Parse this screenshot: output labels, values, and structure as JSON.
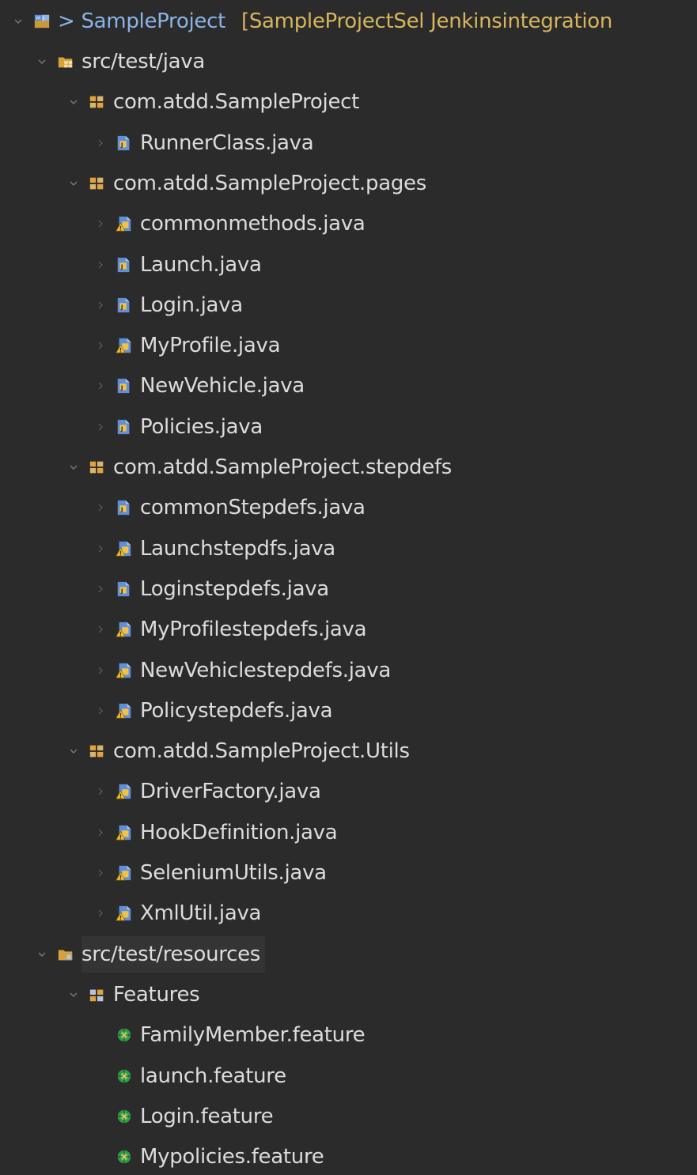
{
  "project": {
    "prefix": "> ",
    "name": "SampleProject",
    "decoration": "[SampleProjectSel Jenkinsintegration"
  },
  "tree": [
    {
      "label": "src/test/java",
      "kind": "source-folder",
      "depth": 1,
      "expanded": true,
      "icon": "source-folder-icon"
    },
    {
      "label": "com.atdd.SampleProject",
      "kind": "package",
      "depth": 2,
      "expanded": true,
      "icon": "package-icon"
    },
    {
      "label": "RunnerClass.java",
      "kind": "java",
      "depth": 3,
      "expanded": false,
      "icon": "java-file-icon"
    },
    {
      "label": "com.atdd.SampleProject.pages",
      "kind": "package",
      "depth": 2,
      "expanded": true,
      "icon": "package-icon"
    },
    {
      "label": "commonmethods.java",
      "kind": "java-warn",
      "depth": 3,
      "expanded": false,
      "icon": "java-file-warning-icon"
    },
    {
      "label": "Launch.java",
      "kind": "java",
      "depth": 3,
      "expanded": false,
      "icon": "java-file-icon"
    },
    {
      "label": "Login.java",
      "kind": "java",
      "depth": 3,
      "expanded": false,
      "icon": "java-file-icon"
    },
    {
      "label": "MyProfile.java",
      "kind": "java-warn",
      "depth": 3,
      "expanded": false,
      "icon": "java-file-warning-icon"
    },
    {
      "label": "NewVehicle.java",
      "kind": "java",
      "depth": 3,
      "expanded": false,
      "icon": "java-file-icon"
    },
    {
      "label": "Policies.java",
      "kind": "java",
      "depth": 3,
      "expanded": false,
      "icon": "java-file-icon"
    },
    {
      "label": "com.atdd.SampleProject.stepdefs",
      "kind": "package",
      "depth": 2,
      "expanded": true,
      "icon": "package-icon"
    },
    {
      "label": "commonStepdefs.java",
      "kind": "java",
      "depth": 3,
      "expanded": false,
      "icon": "java-file-icon"
    },
    {
      "label": "Launchstepdfs.java",
      "kind": "java-warn",
      "depth": 3,
      "expanded": false,
      "icon": "java-file-warning-icon"
    },
    {
      "label": "Loginstepdefs.java",
      "kind": "java",
      "depth": 3,
      "expanded": false,
      "icon": "java-file-icon"
    },
    {
      "label": "MyProfilestepdefs.java",
      "kind": "java-warn",
      "depth": 3,
      "expanded": false,
      "icon": "java-file-warning-icon"
    },
    {
      "label": "NewVehiclestepdefs.java",
      "kind": "java-warn",
      "depth": 3,
      "expanded": false,
      "icon": "java-file-warning-icon"
    },
    {
      "label": "Policystepdefs.java",
      "kind": "java-warn",
      "depth": 3,
      "expanded": false,
      "icon": "java-file-warning-icon"
    },
    {
      "label": "com.atdd.SampleProject.Utils",
      "kind": "package",
      "depth": 2,
      "expanded": true,
      "icon": "package-icon"
    },
    {
      "label": "DriverFactory.java",
      "kind": "java-warn",
      "depth": 3,
      "expanded": false,
      "icon": "java-file-warning-icon"
    },
    {
      "label": "HookDefinition.java",
      "kind": "java-warn",
      "depth": 3,
      "expanded": false,
      "icon": "java-file-warning-icon"
    },
    {
      "label": "SeleniumUtils.java",
      "kind": "java-warn",
      "depth": 3,
      "expanded": false,
      "icon": "java-file-warning-icon"
    },
    {
      "label": "XmlUtil.java",
      "kind": "java-warn",
      "depth": 3,
      "expanded": false,
      "icon": "java-file-warning-icon"
    },
    {
      "label": "src/test/resources",
      "kind": "resource-folder",
      "depth": 1,
      "expanded": true,
      "selected": true,
      "icon": "resource-folder-icon"
    },
    {
      "label": "Features",
      "kind": "folder-package",
      "depth": 2,
      "expanded": true,
      "icon": "folder-package-icon"
    },
    {
      "label": "FamilyMember.feature",
      "kind": "feature",
      "depth": 3,
      "icon": "cucumber-feature-icon"
    },
    {
      "label": "launch.feature",
      "kind": "feature",
      "depth": 3,
      "icon": "cucumber-feature-icon"
    },
    {
      "label": "Login.feature",
      "kind": "feature",
      "depth": 3,
      "icon": "cucumber-feature-icon"
    },
    {
      "label": "Mypolicies.feature",
      "kind": "feature",
      "depth": 3,
      "icon": "cucumber-feature-icon"
    }
  ],
  "colors": {
    "background": "#2b2b2b",
    "text": "#dcdcdc",
    "project_name": "#8ab4e6",
    "decoration": "#d8b55c",
    "selection": "#343434",
    "arrow": "#7a7a7a"
  }
}
